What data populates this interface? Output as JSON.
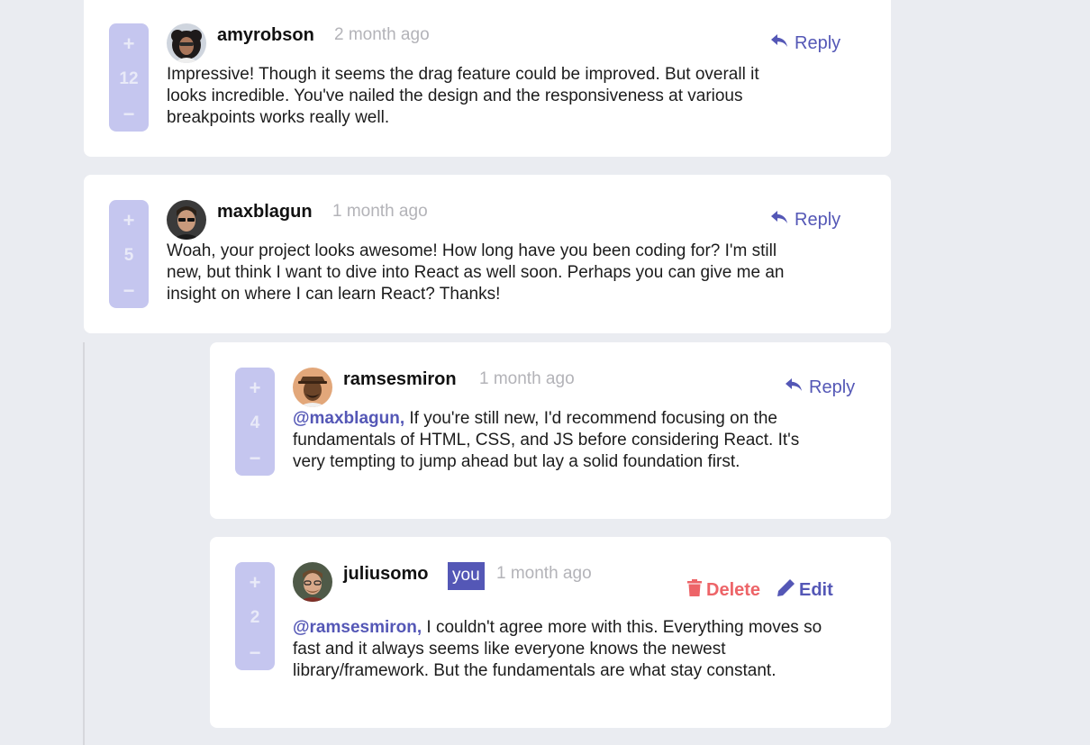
{
  "comments": [
    {
      "username": "amyrobson",
      "time": "2 month ago",
      "score": "12",
      "reply_label": "Reply",
      "text": "Impressive! Though it seems the drag feature could be improved. But overall it looks incredible. You've nailed the design and the responsiveness at various breakpoints works really well."
    },
    {
      "username": "maxblagun",
      "time": "1 month ago",
      "score": "5",
      "reply_label": "Reply",
      "text": "Woah, your project looks awesome! How long have you been coding for? I'm still new, but think I want to dive into React as well soon. Perhaps you can give me an insight on where I can learn React? Thanks!"
    }
  ],
  "replies": [
    {
      "username": "ramsesmiron",
      "time": "1 month ago",
      "score": "4",
      "reply_label": "Reply",
      "mention": "@maxblagun,",
      "text": " If you're still new, I'd recommend focusing on the fundamentals of HTML, CSS, and JS before considering React. It's very tempting to jump ahead but lay a solid foundation first."
    },
    {
      "username": "juliusomo",
      "you_badge": "you",
      "time": "1 month ago",
      "score": "2",
      "delete_label": "Delete",
      "edit_label": "Edit",
      "mention": "@ramsesmiron,",
      "text": " I couldn't agree more with this. Everything moves so fast and it always seems like everyone knows the newest library/framework. But the fundamentals are what stay constant."
    }
  ],
  "vote": {
    "plus": "+",
    "minus": "−"
  },
  "colors": {
    "background": "#eaecf1",
    "accent": "#5457b6",
    "vote_bg": "#c5c6ef",
    "delete": "#ed6468",
    "muted": "#b3b3b8"
  },
  "icons": {
    "reply": "reply-arrow-icon",
    "delete": "trash-icon",
    "edit": "pencil-icon"
  }
}
